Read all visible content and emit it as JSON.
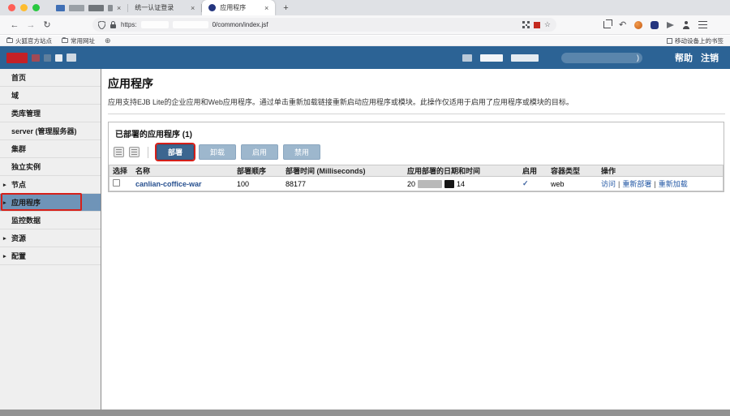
{
  "browser": {
    "close_glyph": "×",
    "new_tab_glyph": "+",
    "back_glyph": "←",
    "forward_glyph": "→",
    "reload_glyph": "↻",
    "undo_glyph": "↶",
    "star_glyph": "☆",
    "tabs": [
      {
        "title": ""
      },
      {
        "title": "统一认证登录"
      },
      {
        "title": "应用程序"
      }
    ],
    "url": {
      "scheme": "https:",
      "path": "0/common/index.jsf"
    },
    "bookmarks": {
      "items": [
        "火狐官方站点",
        "常用网址"
      ],
      "globe_glyph": "⊕",
      "mobile_label": "移动设备上的书签"
    }
  },
  "app_header": {
    "account_suffix": ")",
    "help_label": "帮助",
    "logout_label": "注销"
  },
  "sidebar": {
    "items": [
      {
        "label": "首页",
        "arrow": ""
      },
      {
        "label": "域",
        "arrow": ""
      },
      {
        "label": "类库管理",
        "arrow": ""
      },
      {
        "label": "server (管理服务器)",
        "arrow": ""
      },
      {
        "label": "集群",
        "arrow": ""
      },
      {
        "label": "独立实例",
        "arrow": ""
      },
      {
        "label": "节点",
        "arrow": "▸"
      },
      {
        "label": "应用程序",
        "arrow": "▸"
      },
      {
        "label": "监控数据",
        "arrow": ""
      },
      {
        "label": "资源",
        "arrow": "▸"
      },
      {
        "label": "配置",
        "arrow": "▸"
      }
    ]
  },
  "main": {
    "title": "应用程序",
    "description": "应用支持EJB Lite的企业应用和Web应用程序。通过单击重新加载链接重新启动应用程序或模块。此操作仅适用于启用了应用程序或模块的目标。",
    "section": {
      "title": "已部署的应用程序 (1)",
      "buttons": [
        "部署",
        "卸载",
        "启用",
        "禁用"
      ],
      "table": {
        "headers": [
          "选择",
          "名称",
          "部署顺序",
          "部署时间 (Milliseconds)",
          "应用部署的日期和时间",
          "启用",
          "容器类型",
          "操作"
        ],
        "action_separator": "|",
        "row": {
          "name": "canlian-coffice-war",
          "deploy_order": "100",
          "deploy_time_ms": "88177",
          "date_prefix": "20",
          "date_suffix": "14",
          "enabled_glyph": "✓",
          "container_type": "web",
          "actions": [
            "访问",
            "重新部署",
            "重新加载"
          ]
        }
      }
    }
  },
  "colors": {
    "app_header_bg": "#2c6395",
    "annotation_red": "#d6201a",
    "button_bg": "#9db7cd",
    "button_primary_bg": "#3c6690",
    "selected_sidebar_bg": "#6f94b8",
    "link_blue": "#27508f",
    "check_blue": "#3c62a0"
  }
}
